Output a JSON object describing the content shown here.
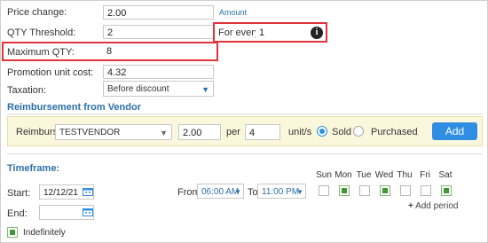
{
  "price_change": {
    "label": "Price change:",
    "value": "2.00",
    "link": "Amount"
  },
  "qty_threshold": {
    "label": "QTY Threshold:",
    "value": "2"
  },
  "for_every": {
    "label": "For every:",
    "value": "1"
  },
  "maximum_qty": {
    "label": "Maximum QTY:",
    "value": "8"
  },
  "promotion_unit_cost": {
    "label": "Promotion unit cost:",
    "value": "4.32"
  },
  "taxation": {
    "label": "Taxation:",
    "value": "Before discount"
  },
  "reimbursement": {
    "title": "Reimbursement from Vendor",
    "label": "Reimburse",
    "vendor": "TESTVENDOR",
    "amount": "2.00",
    "per_label": "per",
    "per_value": "4",
    "unit_label": "unit/s",
    "option_sold": "Sold",
    "option_purchased": "Purchased",
    "selected": "Sold",
    "add_button": "Add"
  },
  "timeframe": {
    "title": "Timeframe:",
    "start_label": "Start:",
    "start_value": "12/12/21",
    "end_label": "End:",
    "end_value": "",
    "from_label": "From",
    "from_value": "06:00 AM",
    "to_label": "To",
    "to_value": "11:00 PM",
    "days": [
      {
        "label": "Sun",
        "checked": false
      },
      {
        "label": "Mon",
        "checked": true
      },
      {
        "label": "Tue",
        "checked": false
      },
      {
        "label": "Wed",
        "checked": true
      },
      {
        "label": "Thu",
        "checked": false
      },
      {
        "label": "Fri",
        "checked": false
      },
      {
        "label": "Sat",
        "checked": true
      }
    ],
    "add_period": "Add period",
    "indefinitely_label": "Indefinitely",
    "indefinitely_checked": true
  },
  "colors": {
    "highlight": "#e0333c",
    "accent": "#2f8de4",
    "section_title": "#2d6fa8",
    "check_green": "#3c9a32"
  }
}
